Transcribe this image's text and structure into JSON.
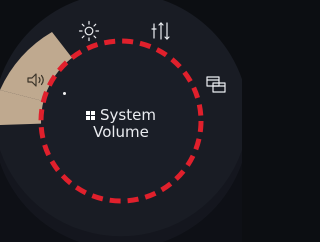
{
  "dial": {
    "center": {
      "icon": "windows-icon",
      "line1": "System",
      "line2": "Volume"
    },
    "tools": [
      {
        "id": "brightness",
        "icon": "sun-icon",
        "selected": false
      },
      {
        "id": "adjust",
        "icon": "sliders-arrows-icon",
        "selected": false
      },
      {
        "id": "screen",
        "icon": "screen-swap-icon",
        "selected": false
      },
      {
        "id": "volume",
        "icon": "speaker-icon",
        "selected": true
      }
    ]
  },
  "colors": {
    "background": "#0c0e12",
    "ring": "#191c24",
    "ring_edge": "#242936",
    "center_disc": "#1a1e27",
    "selected_segment": "#bfa98f",
    "dashed_focus": "#e0202c",
    "icon": "#eceef2"
  }
}
